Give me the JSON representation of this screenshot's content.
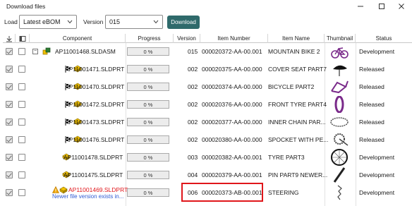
{
  "window": {
    "title": "Download files",
    "minimize_icon": "minimize-icon",
    "maximize_icon": "maximize-icon",
    "close_icon": "close-icon"
  },
  "toolbar": {
    "load_label": "Load",
    "load_value": "Latest eBOM",
    "version_label": "Version",
    "version_value": "015",
    "download_label": "Download",
    "download_color": "#2f6a6b"
  },
  "columns": {
    "component": "Component",
    "progress": "Progress",
    "version": "Version",
    "item_number": "Item Number",
    "item_name": "Item Name",
    "thumbnail": "Thumbnail",
    "status": "Status"
  },
  "rows": [
    {
      "component": "AP11001468.SLDASM",
      "progress": "0 %",
      "version": "015",
      "item_number": "000020372-AA-00.001",
      "item_name": "MOUNTAIN BIKE 2",
      "status": "Development",
      "checked": true,
      "thumb": "bike-thumbnail"
    },
    {
      "component": "AP11001471.SLDPRT",
      "progress": "0 %",
      "version": "002",
      "item_number": "000020375-AA-00.000",
      "item_name": "COVER SEAT PART7",
      "status": "Released",
      "checked": true,
      "thumb": "seat-thumbnail"
    },
    {
      "component": "AP11001470.SLDPRT",
      "progress": "0 %",
      "version": "002",
      "item_number": "000020374-AA-00.000",
      "item_name": "BICYCLE PART2",
      "status": "Released",
      "checked": true,
      "thumb": "frame-thumbnail"
    },
    {
      "component": "AP11001472.SLDPRT",
      "progress": "0 %",
      "version": "002",
      "item_number": "000020376-AA-00.000",
      "item_name": "FRONT TYRE PART4",
      "status": "Released",
      "checked": true,
      "thumb": "tyre-thumbnail"
    },
    {
      "component": "AP11001473.SLDPRT",
      "progress": "0 %",
      "version": "002",
      "item_number": "000020377-AA-00.000",
      "item_name": "INNER CHAIN PAR...",
      "status": "Released",
      "checked": true,
      "thumb": "chain-thumbnail"
    },
    {
      "component": "AP11001476.SLDPRT",
      "progress": "0 %",
      "version": "002",
      "item_number": "000020380-AA-00.000",
      "item_name": "SPOCKET WITH PE...",
      "status": "Released",
      "checked": true,
      "thumb": "sprocket-thumbnail"
    },
    {
      "component": "AP11001478.SLDPRT",
      "progress": "0 %",
      "version": "003",
      "item_number": "000020382-AA-00.001",
      "item_name": "TYRE PART3",
      "status": "Development",
      "checked": true,
      "thumb": "wheel-thumbnail"
    },
    {
      "component": "AP11001475.SLDPRT",
      "progress": "0 %",
      "version": "004",
      "item_number": "000020379-AA-00.001",
      "item_name": "PIN PART9 NEWER...",
      "status": "Development",
      "checked": true,
      "thumb": "pin-thumbnail"
    },
    {
      "component": "AP11001469.SLDPRT",
      "progress": "0 %",
      "version": "006",
      "item_number": "000020373-AB-00.001",
      "item_name": "STEERING",
      "status": "Development",
      "checked": true,
      "thumb": "steering-thumbnail",
      "warning": "Newer file version exists in..."
    }
  ],
  "colors": {
    "warning_text": "#e0161b",
    "link_text": "#2f5bd3",
    "highlight_border": "#e0161b"
  }
}
